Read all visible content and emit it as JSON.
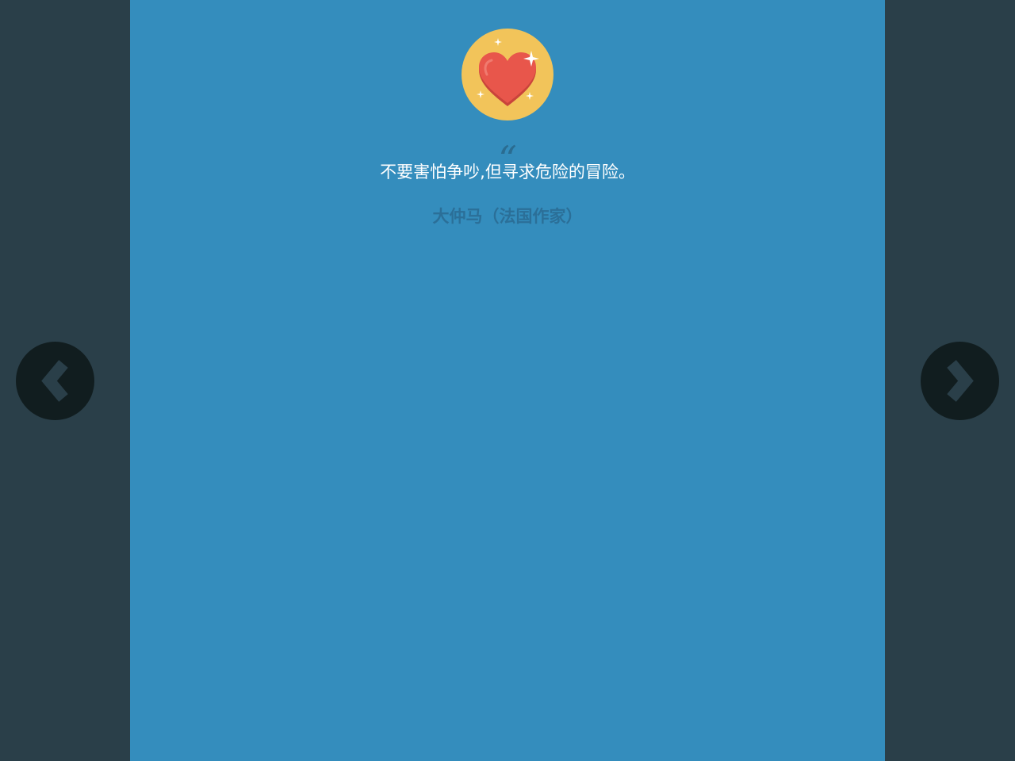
{
  "quote": {
    "open_mark": "“",
    "text": "不要害怕争吵,但寻求危险的冒险。",
    "author": "大仲马（法国作家）"
  },
  "badge": {
    "icon": "heart-sparkle-icon",
    "circle_color": "#f2c45a",
    "heart_color": "#e8564b"
  },
  "navigation": {
    "prev_icon": "chevron-left-icon",
    "next_icon": "chevron-right-icon"
  },
  "colors": {
    "background": "#2a3f49",
    "card": "#348dbd",
    "author_text": "#2b6f98",
    "nav_button": "#111d1f",
    "nav_chevron": "#2a3f49"
  }
}
